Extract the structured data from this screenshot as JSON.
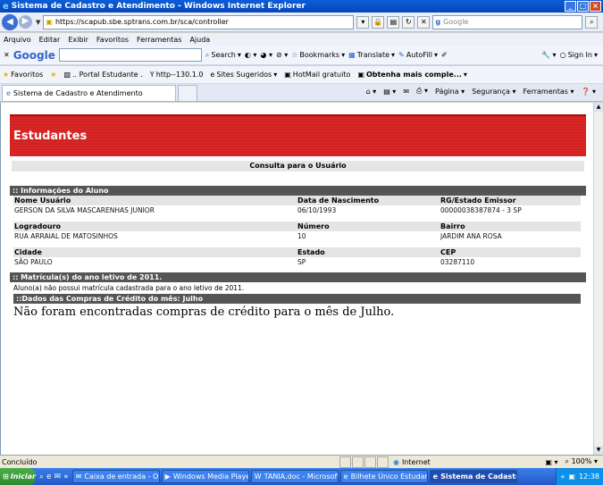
{
  "window": {
    "title": "Sistema de Cadastro e Atendimento - Windows Internet Explorer"
  },
  "address": {
    "url": "https://scapub.sbe.sptrans.com.br/sca/controller",
    "search_placeholder": "Google"
  },
  "menu": [
    "Arquivo",
    "Editar",
    "Exibir",
    "Favoritos",
    "Ferramentas",
    "Ajuda"
  ],
  "googlebar": {
    "logo": "Google",
    "search_label": "Search",
    "bookmarks_label": "Bookmarks",
    "translate_label": "Translate",
    "autofill_label": "AutoFill",
    "signin_label": "Sign In"
  },
  "favorites": {
    "label": "Favoritos",
    "items": [
      ".. Portal Estudante .",
      "http--130.1.0",
      "Sites Sugeridos",
      "HotMail gratuito",
      "Obtenha mais comple..."
    ]
  },
  "tab": {
    "label": "Sistema de Cadastro e Atendimento"
  },
  "commandbar": {
    "pagina": "Página",
    "seguranca": "Segurança",
    "ferramentas": "Ferramentas"
  },
  "page": {
    "header": "Estudantes",
    "consulta": "Consulta para o Usuário",
    "aluno": {
      "section": ":: Informações do Aluno",
      "labels": {
        "nome": "Nome Usuário",
        "nascimento": "Data de Nascimento",
        "rg": "RG/Estado Emissor",
        "logradouro": "Logradouro",
        "numero": "Número",
        "bairro": "Bairro",
        "cidade": "Cidade",
        "estado": "Estado",
        "cep": "CEP"
      },
      "values": {
        "nome": "GERSON DA SILVA MASCARENHAS JUNIOR",
        "nascimento": "06/10/1993",
        "rg": "00000038387874 - 3  SP",
        "logradouro": "RUA ARRAIAL DE MATOSINHOS",
        "numero": "10",
        "bairro": "JARDIM ANA ROSA",
        "cidade": "SÃO PAULO",
        "estado": "SP",
        "cep": "03287110"
      }
    },
    "matricula": {
      "section": ":: Matrícula(s) do ano letivo de 2011.",
      "note": "Aluno(a) não possui matrícula cadastrada para o ano letivo de 2011."
    },
    "compras": {
      "section": "::Dados das Compras de Crédito do mês: Julho",
      "message": "Não foram encontradas compras de crédito para o mês de Julho."
    }
  },
  "status": {
    "left": "Concluído",
    "zone": "Internet",
    "zoom": "100%"
  },
  "taskbar": {
    "start": "Iniciar",
    "buttons": [
      "Caixa de entrada - Ou...",
      "Windows Media Player",
      "TANIA.doc - Microsoft ...",
      "Bilhete Único Estudant...",
      "Sistema de Cadastr..."
    ],
    "clock": "12:38"
  }
}
